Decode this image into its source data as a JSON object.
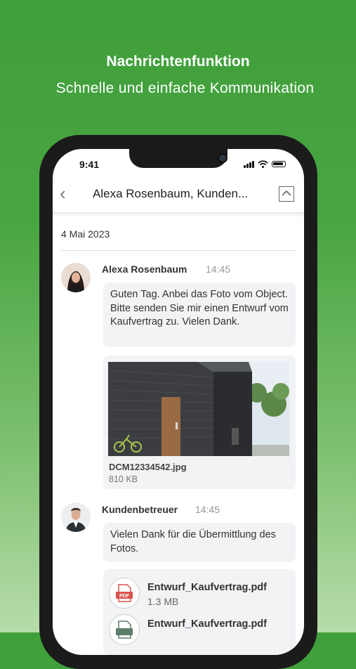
{
  "promo": {
    "headline": "Nachrichtenfunktion",
    "subline": "Schnelle und einfache Kommunikation",
    "background": "#49a542"
  },
  "status_bar": {
    "time": "9:41"
  },
  "chat": {
    "title": "Alexa Rosenbaum, Kunden...",
    "date": "4 Mai 2023",
    "messages": [
      {
        "sender": "Alexa Rosenbaum",
        "time": "14:45",
        "text": "Guten Tag. Anbei das Foto vom Object. Bitte senden Sie mir einen Entwurf vom Kaufvertrag zu. Vielen Dank.",
        "attachment": {
          "name": "DCM12334542.jpg",
          "size": "810 KB"
        }
      },
      {
        "sender": "Kundenbetreuer",
        "time": "14:45",
        "text": "Vielen Dank für die Übermittlung des Fotos.",
        "files": [
          {
            "name": "Entwurf_Kaufvertrag.pdf",
            "size": "1.3 MB",
            "icon": "pdf-icon",
            "color": "#d9534f"
          },
          {
            "name": "Entwurf_Kaufvertrag.pdf",
            "size": "",
            "icon": "pdf-icon",
            "color": "#5d7d6a"
          }
        ]
      }
    ]
  }
}
